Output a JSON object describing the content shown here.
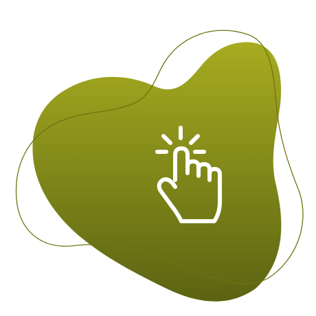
{
  "graphic": {
    "icon": "tap-hand-icon",
    "colors": {
      "background": "#ffffff",
      "blob_top": "#a7ac20",
      "blob_bottom": "#5b6312",
      "outline": "#6e7410",
      "icon": "#ffffff"
    }
  }
}
